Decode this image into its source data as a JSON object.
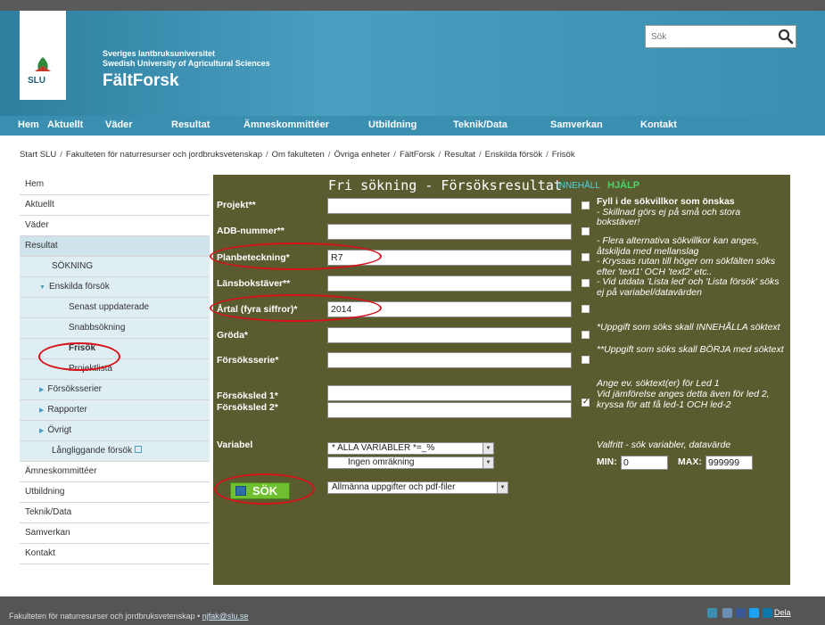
{
  "header": {
    "university_sv": "Sveriges lantbruksuniversitet",
    "university_en": "Swedish University of Agricultural Sciences",
    "logo_text": "SLU",
    "site_title": "FältForsk",
    "search_placeholder": "Sök"
  },
  "topnav": [
    "Hem",
    "Aktuellt",
    "Väder",
    "Resultat",
    "Ämneskommittéer",
    "Utbildning",
    "Teknik/Data",
    "Samverkan",
    "Kontakt"
  ],
  "breadcrumb": [
    "Start SLU",
    "Fakulteten för naturresurser och jordbruksvetenskap",
    "Om fakulteten",
    "Övriga enheter",
    "FältForsk",
    "Resultat",
    "Enskilda försök",
    "Frisök"
  ],
  "sidebar": {
    "hem": "Hem",
    "aktuellt": "Aktuellt",
    "vader": "Väder",
    "resultat": "Resultat",
    "sokning": "SÖKNING",
    "enskilda": "Enskilda försök",
    "senast": "Senast uppdaterade",
    "snabbsokning": "Snabbsökning",
    "frisok": "Frisök",
    "projektlista": "Projektlista",
    "forsoksserier": "Försöksserier",
    "rapporter": "Rapporter",
    "ovrigt": "Övrigt",
    "langliggande": "Långliggande försök",
    "amnes": "Ämneskommittéer",
    "utbildning": "Utbildning",
    "teknik": "Teknik/Data",
    "samverkan": "Samverkan",
    "kontakt": "Kontakt"
  },
  "form": {
    "title": "Fri sökning - Försöksresultat",
    "innehall": "INNEHÅLL",
    "hjalp": "HJÄLP",
    "labels": {
      "projekt": "Projekt**",
      "adb": "ADB-nummer**",
      "plan": "Planbeteckning*",
      "lans": "Länsbokstäver**",
      "artal": "Årtal (fyra siffror)*",
      "groda": "Gröda*",
      "serie": "Försöksserie*",
      "led1": "Försöksled 1*",
      "led2": "Försöksled 2*",
      "variabel": "Variabel"
    },
    "values": {
      "projekt": "",
      "adb": "",
      "plan": "R7",
      "lans": "",
      "artal": "2014",
      "groda": "",
      "serie": "",
      "led1": "",
      "led2": ""
    },
    "select_variabel": "* ALLA VARIABLER *=_%",
    "select_omrakning": "Ingen omräkning",
    "select_output": "Allmänna uppgifter och pdf-filer",
    "sok_button": "SÖK",
    "help_1_bold": "Fyll i de sökvillkor som önskas",
    "help_1": "- Skillnad görs ej på små och stora bokstäver!",
    "help_2": "- Flera alternativa sökvillkor kan anges, åtskiljda med mellanslag",
    "help_3": "- Kryssas rutan till höger om sökfälten söks efter 'text1' OCH 'text2' etc..",
    "help_4": "- Vid utdata 'Lista led' och 'Lista försök' söks ej på variabel/datavärden",
    "help_5": "*Uppgift som söks skall INNEHÅLLA söktext",
    "help_6": "**Uppgift som söks skall BÖRJA med söktext",
    "help_7": "Ange ev. söktext(er) för Led 1",
    "help_8": "Vid jämförelse anges detta även för led 2, kryssa för att få led-1 OCH led-2",
    "help_9": "Valfritt - sök variabler, datavärde",
    "min_label": "MIN:",
    "min_value": "0",
    "max_label": "MAX:",
    "max_value": "999999"
  },
  "footer": {
    "text": "Fakulteten för naturresurser och jordbruksvetenskap • ",
    "email": "njfak@slu.se",
    "dela": "Dela"
  },
  "colors": {
    "header_blue": "#3a8fb0",
    "panel_olive": "#5b5b30",
    "ring_red": "#d8121a",
    "sok_green": "#6fbf2e"
  }
}
